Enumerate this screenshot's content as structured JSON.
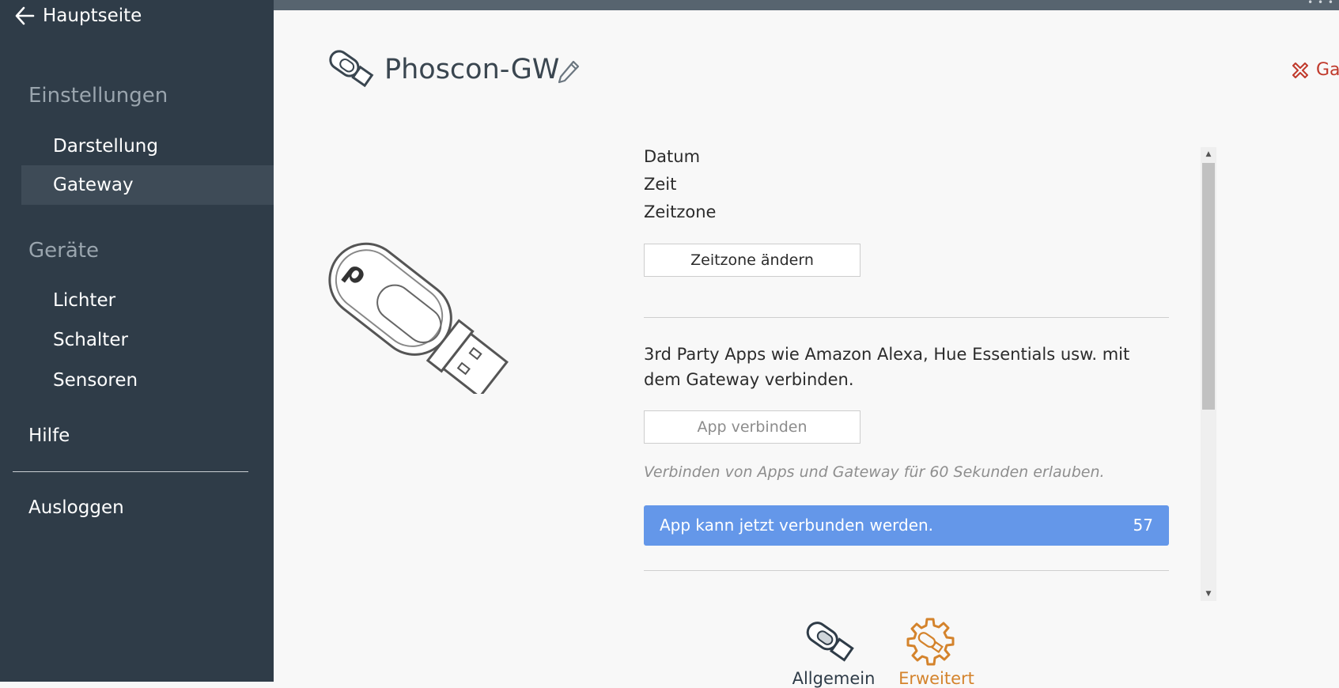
{
  "sidebar": {
    "back_label": "Hauptseite",
    "sections": {
      "settings_title": "Einstellungen",
      "settings_items": [
        "Darstellung",
        "Gateway"
      ],
      "devices_title": "Geräte",
      "devices_items": [
        "Lichter",
        "Schalter",
        "Sensoren"
      ]
    },
    "help_label": "Hilfe",
    "logout_label": "Ausloggen",
    "active_item": "Gateway"
  },
  "header": {
    "title": "Phoscon-GW",
    "close_label": "Ga"
  },
  "time": {
    "date_label": "Datum",
    "time_label": "Zeit",
    "timezone_label": "Zeitzone",
    "change_timezone_button": "Zeitzone ändern"
  },
  "apps": {
    "description": "3rd Party Apps wie Amazon Alexa, Hue Essentials usw. mit dem Gateway verbinden.",
    "connect_button": "App verbinden",
    "hint": "Verbinden von Apps und Gateway für 60 Sekunden erlauben.",
    "status_text": "App kann jetzt verbunden werden.",
    "countdown": "57"
  },
  "tabs": {
    "general_label": "Allgemein",
    "advanced_label": "Erweitert",
    "active_tab": "Erweitert"
  },
  "colors": {
    "sidebar_bg": "#2f3c48",
    "accent_blue": "#6497e9",
    "accent_orange": "#d4832c",
    "danger_red": "#c0392b"
  }
}
